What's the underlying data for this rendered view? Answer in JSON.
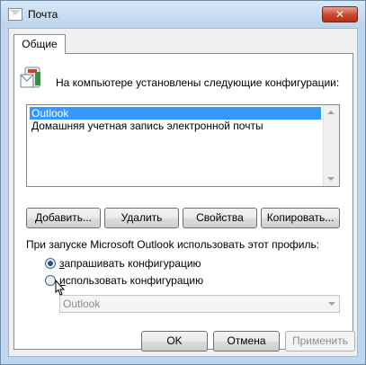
{
  "window": {
    "title": "Почта",
    "close_label": "✕"
  },
  "tabs": [
    {
      "label": "Общие",
      "active": true
    }
  ],
  "general": {
    "heading": "На компьютере установлены следующие конфигурации:",
    "profiles": [
      {
        "label": "Outlook",
        "selected": true
      },
      {
        "label": "Домашняя учетная запись электронной почты",
        "selected": false
      }
    ],
    "buttons": {
      "add": "Добавить...",
      "remove": "Удалить",
      "properties": "Свойства",
      "copy": "Копировать..."
    },
    "startup_prompt": "При запуске Microsoft Outlook использовать этот профиль:",
    "radio_prompt": "запрашивать конфигурацию",
    "radio_use": "использовать конфигурацию",
    "radio_selected": "prompt",
    "profile_combo_value": "Outlook"
  },
  "footer": {
    "ok": "OK",
    "cancel": "Отмена",
    "apply": "Применить"
  },
  "colors": {
    "selection": "#3399ff",
    "close_button": "#c9452b",
    "frame": "#bfd6ee"
  },
  "icons": {
    "app": "mail-app-icon",
    "heading": "mail-profile-icon",
    "cursor": "mouse-pointer-icon"
  }
}
